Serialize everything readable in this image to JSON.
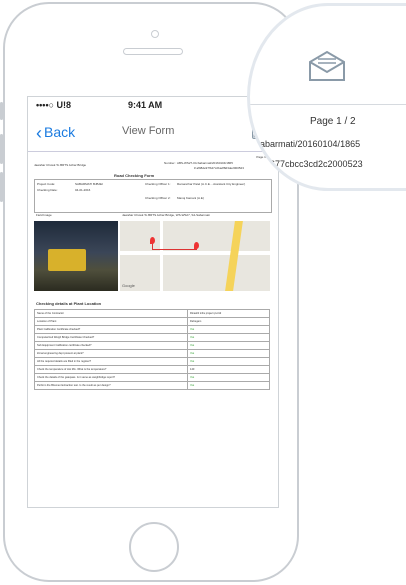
{
  "status_bar": {
    "carrier": "••••○ U!8",
    "time": "9:41 AM"
  },
  "nav": {
    "back_label": "Back",
    "title": "View Form",
    "mail_icon": "envelope-open-icon"
  },
  "document": {
    "page_label": "Page 1 / 2",
    "header_left": "Jawahar Chowk To BRTS Achar Bridge",
    "number_label": "Number : ABS-WS27-04-Sabarmati/20160104/1865",
    "hash": "# af98de97fb47c2ba2f8d3de2000523",
    "form_title": "Road Checking Form",
    "project": {
      "code_label": "Project Code:",
      "code_value": "SABARMATI BJBJEI",
      "date_label": "Checking Date:",
      "date_value": "04-01-2016",
      "officer1_label": "Checking Officer 1:",
      "officer1_value": "Ramanchar Patel (A.C.E. - Assistant City Engineer)",
      "officer2_label": "Checking Officer 2:",
      "officer2_value": "Manoj Kamani (A.E)"
    },
    "field_image_label": "Field Image",
    "location_text": "Jawahar Chowk To BRTS Achar Bridge, WS-WS27, S4-Sabarmati",
    "map_brand": "Google",
    "section_title": "Checking details at Plant Location",
    "rows": [
      {
        "q": "Name of the Contractor",
        "a": "Rinashil infra project pvt.ltd"
      },
      {
        "q": "Location of Plant",
        "a": "Dehegam"
      },
      {
        "q": "Plant Calibration Certificate checked?",
        "a": "Yes"
      },
      {
        "q": "Computerized Weigh Bridge Certificate Checked?",
        "a": "Yes"
      },
      {
        "q": "Sub Equipment Calibration certificate checked?",
        "a": "Yes"
      },
      {
        "q": "Zonal engineering dept present at plant?",
        "a": "Yes"
      },
      {
        "q": "All the required details are filled in the register?",
        "a": "Yes"
      },
      {
        "q": "Check the temperature of Hot Mix. What is the temperature?",
        "a": "140"
      },
      {
        "q": "Check the details of the gatepass. Is it same as weighbridge report?",
        "a": "Yes"
      },
      {
        "q": "Perform the Bitumen Extraction test. Is the result as per design?",
        "a": "Yes"
      }
    ]
  },
  "magnifier": {
    "page": "Page 1 / 2",
    "line1": "Sabarmati/20160104/1865",
    "line2": "f9f677cbcc3cd2c2000523"
  },
  "colors": {
    "accent": "#1b7be0",
    "beam": "#bfe0f5",
    "yes": "#2a9d2a"
  }
}
